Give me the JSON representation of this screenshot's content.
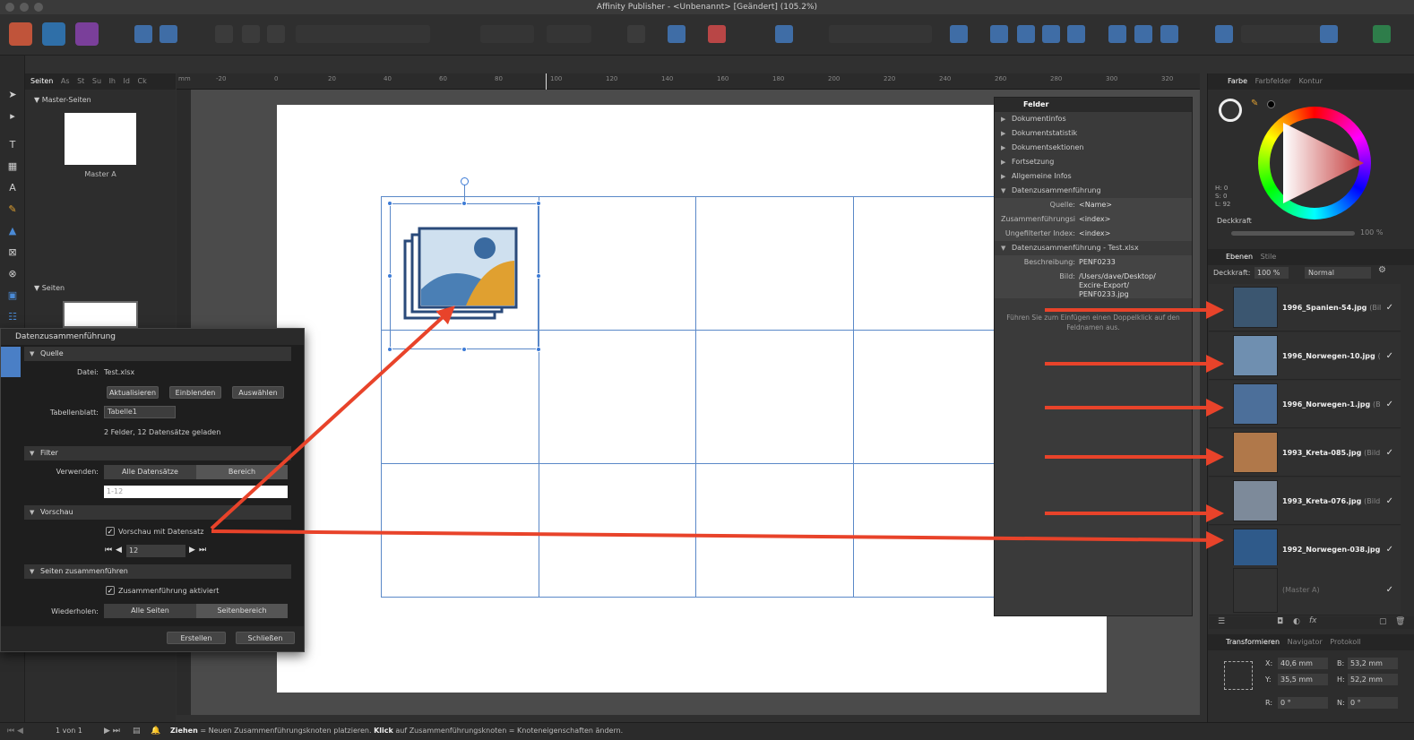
{
  "window": {
    "title": "Affinity Publisher - <Unbenannt> [Geändert] (105.2%)"
  },
  "colors": {
    "accent": "#3c7bd6",
    "arrow": "#e8432a",
    "grid": "#5a88c8"
  },
  "pages_panel": {
    "tabs": [
      "Seiten",
      "As",
      "St",
      "Su",
      "Ih",
      "Id",
      "Ck"
    ],
    "master_section": "Master-Seiten",
    "master_label": "Master A",
    "pages_section": "Seiten"
  },
  "ruler": {
    "unit": "mm",
    "ticks": [
      "-20",
      "0",
      "20",
      "40",
      "60",
      "80",
      "100",
      "120",
      "140",
      "160",
      "180",
      "200",
      "220",
      "240",
      "260",
      "280",
      "300",
      "320"
    ]
  },
  "data_merge": {
    "title": "Datenzusammenführung",
    "source_section": "Quelle",
    "file_label": "Datei:",
    "file_value": "Test.xlsx",
    "btn_refresh": "Aktualisieren",
    "btn_show": "Einblenden",
    "btn_select": "Auswählen",
    "sheet_label": "Tabellenblatt:",
    "sheet_value": "Tabelle1",
    "loaded_text": "2 Felder, 12 Datensätze geladen",
    "filter_section": "Filter",
    "use_label": "Verwenden:",
    "seg_all_records": "Alle Datensätze",
    "seg_range": "Bereich",
    "range_placeholder": "1-12",
    "preview_section": "Vorschau",
    "preview_checkbox": "Vorschau mit Datensatz",
    "record_value": "12",
    "merge_section": "Seiten zusammenführen",
    "merge_checkbox": "Zusammenführung aktiviert",
    "repeat_label": "Wiederholen:",
    "seg_all_pages": "Alle Seiten",
    "seg_page_range": "Seitenbereich",
    "btn_create": "Erstellen",
    "btn_close": "Schließen"
  },
  "felder": {
    "tab": "Felder",
    "groups": [
      "Dokumentinfos",
      "Dokumentstatistik",
      "Dokumentsektionen",
      "Fortsetzung",
      "Allgemeine Infos",
      "Datenzusammenführung"
    ],
    "merge_fields": [
      {
        "k": "Quelle:",
        "v": "<Name>"
      },
      {
        "k": "Zusammenführungsi",
        "v": "<index>"
      },
      {
        "k": "Ungefilterter Index:",
        "v": "<index>"
      }
    ],
    "merge_file_group": "Datenzusammenführung - Test.xlsx",
    "desc_label": "Beschreibung:",
    "desc_value": "PENF0233",
    "image_label": "Bild:",
    "image_value_1": "/Users/dave/Desktop/",
    "image_value_2": "Excire-Export/",
    "image_value_3": "PENF0233.jpg",
    "hint": "Führen Sie zum Einfügen einen Doppelklick auf den Feldnamen aus."
  },
  "color_panel": {
    "tabs": [
      "Farbe",
      "Farbfelder",
      "Kontur"
    ],
    "h": "H: 0",
    "s": "S: 0",
    "l": "L: 92",
    "opacity_label": "Deckkraft",
    "opacity_value": "100 %"
  },
  "layers_panel": {
    "tabs": [
      "Ebenen",
      "Stile"
    ],
    "opacity_label": "Deckkraft:",
    "opacity_value": "100 %",
    "blend": "Normal",
    "layers": [
      {
        "name": "1996_Spanien-54.jpg",
        "suffix": "(Bil",
        "thumb": "#3b5670"
      },
      {
        "name": "1996_Norwegen-10.jpg",
        "suffix": "(I",
        "thumb": "#6f8fb0"
      },
      {
        "name": "1996_Norwegen-1.jpg",
        "suffix": "(Bi",
        "thumb": "#4c6f9a"
      },
      {
        "name": "1993_Kreta-085.jpg",
        "suffix": "(Bild",
        "thumb": "#b0784a"
      },
      {
        "name": "1993_Kreta-076.jpg",
        "suffix": "(Bild",
        "thumb": "#7d8a9a"
      },
      {
        "name": "1992_Norwegen-038.jpg",
        "suffix": "",
        "thumb": "#2f5a8a"
      }
    ],
    "master_layer": "(Master A)"
  },
  "transform_panel": {
    "tabs": [
      "Transformieren",
      "Navigator",
      "Protokoll"
    ],
    "x_label": "X:",
    "x": "40,6 mm",
    "y_label": "Y:",
    "y": "35,5 mm",
    "b_label": "B:",
    "b": "53,2 mm",
    "h_label": "H:",
    "h": "52,2 mm",
    "r_label": "R:",
    "r": "0 °",
    "n_label": "N:",
    "n": "0 °"
  },
  "status": {
    "page": "1 von 1",
    "drag_bold": "Ziehen",
    "drag_text": " = Neuen Zusammenführungsknoten platzieren. ",
    "click_bold": "Klick",
    "click_text": " auf Zusammenführungsknoten = Knoteneigenschaften ändern."
  }
}
